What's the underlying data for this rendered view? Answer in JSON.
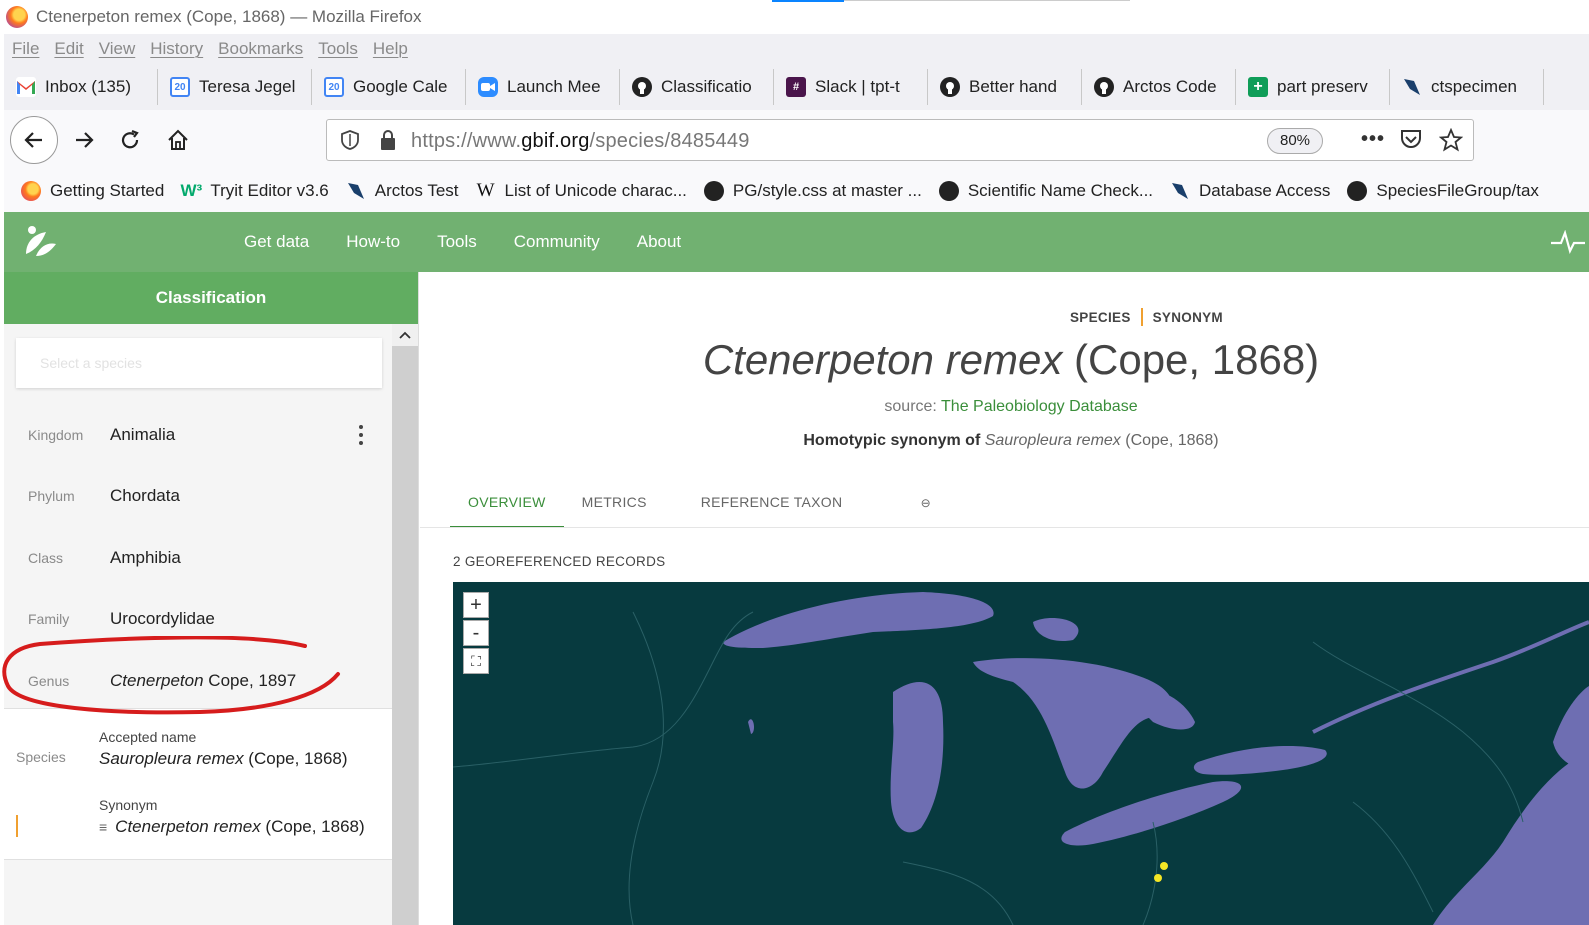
{
  "window": {
    "title": "Ctenerpeton remex (Cope, 1868) — Mozilla Firefox"
  },
  "menu": [
    "File",
    "Edit",
    "View",
    "History",
    "Bookmarks",
    "Tools",
    "Help"
  ],
  "tabs": [
    {
      "label": "Inbox (135)",
      "icon": "gmail-icon",
      "color": "#ea4335"
    },
    {
      "label": "Teresa Jegel",
      "icon": "calendar-icon",
      "color": "#4285f4"
    },
    {
      "label": "Google Cale",
      "icon": "calendar-icon",
      "color": "#4285f4"
    },
    {
      "label": "Launch Mee",
      "icon": "zoom-icon",
      "color": "#2d8cff"
    },
    {
      "label": "Classificatio",
      "icon": "github-icon",
      "color": "#222"
    },
    {
      "label": "Slack | tpt-t",
      "icon": "slack-icon",
      "color": "#4a154b"
    },
    {
      "label": "Better hand",
      "icon": "github-icon",
      "color": "#222"
    },
    {
      "label": "Arctos Code",
      "icon": "github-icon",
      "color": "#222"
    },
    {
      "label": "part preserv",
      "icon": "sheets-icon",
      "color": "#0f9d58"
    },
    {
      "label": "ctspecimen",
      "icon": "arctos-icon",
      "color": "#1a3f6b"
    }
  ],
  "navbar": {
    "url_prefix": "https://www.",
    "url_domain": "gbif.org",
    "url_path": "/species/8485449",
    "zoom": "80%"
  },
  "bookmarks": [
    {
      "label": "Getting Started",
      "icon": "firefox-icon"
    },
    {
      "label": "Tryit Editor v3.6",
      "icon": "w3schools-icon"
    },
    {
      "label": "Arctos Test",
      "icon": "arctos-icon"
    },
    {
      "label": "List of Unicode charac...",
      "icon": "wikipedia-icon"
    },
    {
      "label": "PG/style.css at master ...",
      "icon": "github-icon"
    },
    {
      "label": "Scientific Name Check...",
      "icon": "github-icon"
    },
    {
      "label": "Database Access",
      "icon": "arctos-icon"
    },
    {
      "label": "SpeciesFileGroup/tax",
      "icon": "github-icon"
    }
  ],
  "gbif_nav": [
    "Get data",
    "How-to",
    "Tools",
    "Community",
    "About"
  ],
  "sidebar": {
    "title": "Classification",
    "search_placeholder": "Select a species",
    "ranks": [
      {
        "rank": "Kingdom",
        "value": "Animalia"
      },
      {
        "rank": "Phylum",
        "value": "Chordata"
      },
      {
        "rank": "Class",
        "value": "Amphibia"
      },
      {
        "rank": "Family",
        "value": "Urocordylidae"
      }
    ],
    "genus": {
      "rank": "Genus",
      "value_italic": "Ctenerpeton",
      "value_rest": " Cope, 1897"
    },
    "species": {
      "rank": "Species",
      "accepted_label": "Accepted name",
      "accepted_italic": "Sauropleura remex",
      "accepted_rest": " (Cope, 1868)",
      "synonym_label": "Synonym",
      "synonym_italic": "Ctenerpeton remex",
      "synonym_rest": " (Cope, 1868)"
    }
  },
  "species_page": {
    "tag_species": "SPECIES",
    "tag_synonym": "SYNONYM",
    "title_italic": "Ctenerpeton remex",
    "title_rest": " (Cope, 1868)",
    "source_label": "source:",
    "source_link": "The Paleobiology Database",
    "homotypic_label": "Homotypic synonym of",
    "homotypic_italic": "Sauropleura remex",
    "homotypic_rest": " (Cope, 1868)",
    "tabs": [
      "OVERVIEW",
      "METRICS",
      "REFERENCE TAXON"
    ],
    "georef": "2 GEOREFERENCED RECORDS"
  },
  "colors": {
    "gbif_green": "#71b171",
    "map_bg": "#073a3f",
    "lake": "#6e6eb2",
    "occurrence": "#f5e625",
    "annotation": "#d61c1c"
  }
}
